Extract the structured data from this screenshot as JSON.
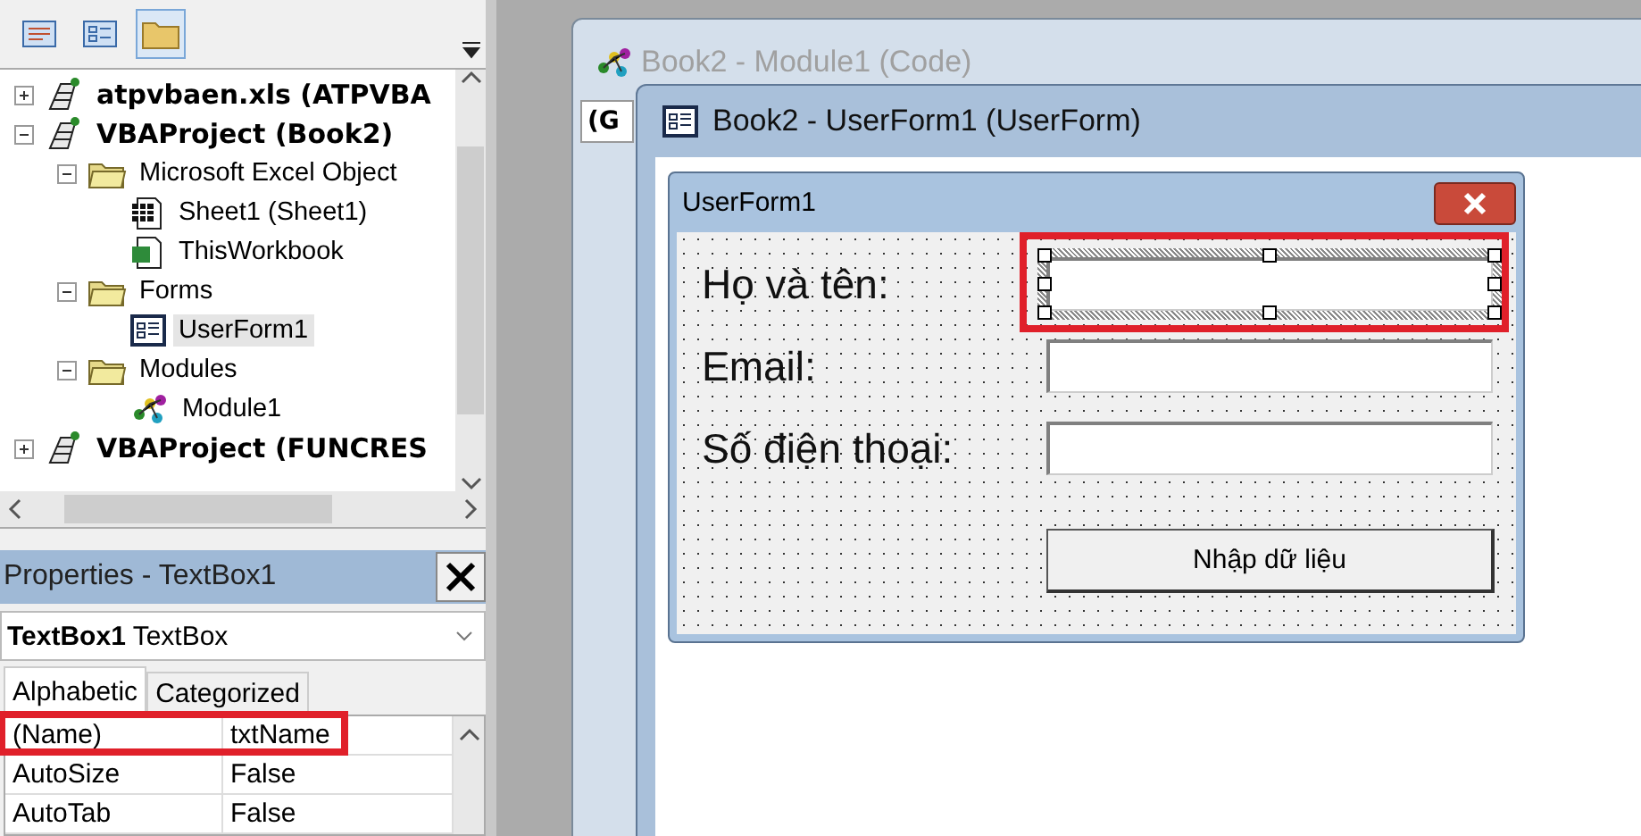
{
  "project_tree": {
    "items": [
      {
        "label": "atpvbaen.xls (ATPVBA",
        "kind": "project",
        "expanded": false,
        "selected": false
      },
      {
        "label": "VBAProject (Book2)",
        "kind": "project",
        "expanded": true,
        "selected": false,
        "children": [
          {
            "label": "Microsoft Excel Object",
            "kind": "folder",
            "expanded": true,
            "selected": false,
            "children": [
              {
                "label": "Sheet1 (Sheet1)",
                "kind": "sheet",
                "selected": false
              },
              {
                "label": "ThisWorkbook",
                "kind": "workbook",
                "selected": false
              }
            ]
          },
          {
            "label": "Forms",
            "kind": "folder",
            "expanded": true,
            "selected": false,
            "children": [
              {
                "label": "UserForm1",
                "kind": "form",
                "selected": true
              }
            ]
          },
          {
            "label": "Modules",
            "kind": "folder",
            "expanded": true,
            "selected": false,
            "children": [
              {
                "label": "Module1",
                "kind": "module",
                "selected": false
              }
            ]
          }
        ]
      },
      {
        "label": "VBAProject (FUNCRES",
        "kind": "project",
        "expanded": false,
        "selected": false
      }
    ]
  },
  "properties": {
    "title": "Properties - TextBox1",
    "object_name": "TextBox1",
    "object_type": "TextBox",
    "tabs": [
      {
        "label": "Alphabetic",
        "selected": true
      },
      {
        "label": "Categorized",
        "selected": false
      }
    ],
    "rows": [
      {
        "name": "(Name)",
        "value": "txtName",
        "highlighted": true
      },
      {
        "name": "AutoSize",
        "value": "False",
        "highlighted": false
      },
      {
        "name": "AutoTab",
        "value": "False",
        "highlighted": false
      }
    ]
  },
  "code_window": {
    "title": "Book2 - Module1 (Code)",
    "combo": "(G"
  },
  "form_window": {
    "title": "Book2 - UserForm1 (UserForm)",
    "form": {
      "caption": "UserForm1",
      "fields": [
        {
          "label": "Họ và tên:",
          "selected": true,
          "highlighted": true
        },
        {
          "label": "Email:",
          "selected": false,
          "highlighted": false
        },
        {
          "label": "Số điện thoại:",
          "selected": false,
          "highlighted": false
        }
      ],
      "button": "Nhập dữ liệu"
    }
  }
}
